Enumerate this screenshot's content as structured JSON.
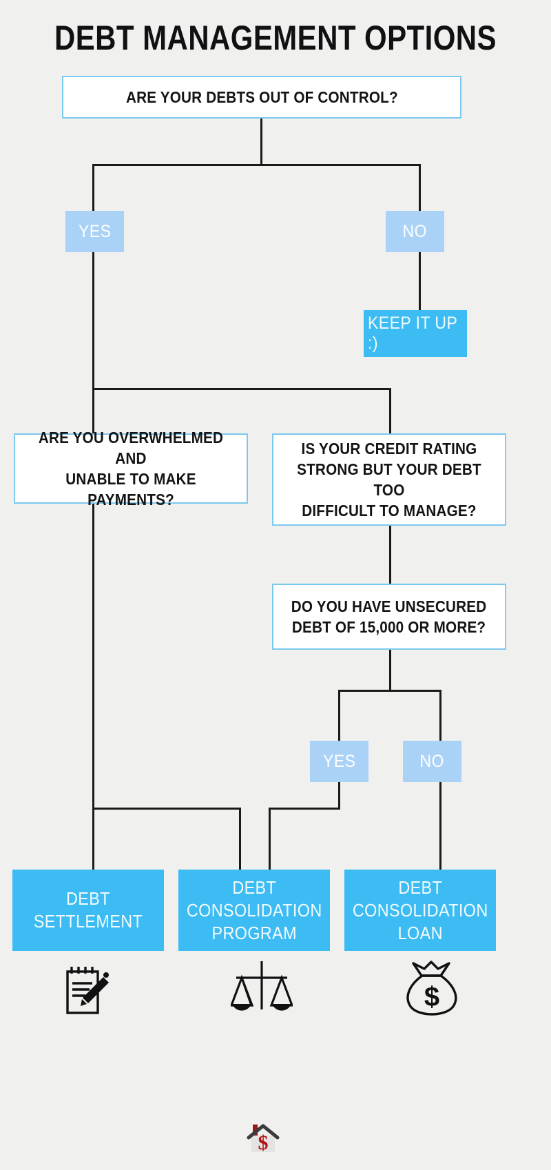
{
  "header": {
    "title": "DEBT MANAGEMENT OPTIONS"
  },
  "colors": {
    "background": "#f0f0ef",
    "accent_light_blue": "#aad2f7",
    "accent_bright_blue": "#3cbcf2",
    "box_border": "#7dc8ef",
    "box_fill": "#ffffff",
    "line": "#1a1a1a",
    "title_text": "#111111",
    "logo_red": "#b41414"
  },
  "nodes": {
    "root_question": "ARE YOUR DEBTS OUT OF CONTROL?",
    "branch_yes_top": "YES",
    "branch_no_top": "NO",
    "keep_it_up": "KEEP IT UP  :)",
    "question_left_line1": "ARE YOU OVERWHELMED AND",
    "question_left_line2": "UNABLE TO MAKE PAYMENTS?",
    "question_right_line1": "IS YOUR CREDIT RATING",
    "question_right_line2": "STRONG BUT YOUR DEBT TOO",
    "question_right_line3": "DIFFICULT TO MANAGE?",
    "question_unsecured_line1": "DO YOU HAVE UNSECURED",
    "question_unsecured_line2": "DEBT OF 15,000 OR MORE?",
    "branch_yes_bottom": "YES",
    "branch_no_bottom": "NO"
  },
  "results": [
    {
      "line1": "DEBT",
      "line2": "SETTLEMENT",
      "line3": "",
      "icon": "notepad-pencil-icon"
    },
    {
      "line1": "DEBT",
      "line2": "CONSOLIDATION",
      "line3": "PROGRAM",
      "icon": "balance-scales-icon"
    },
    {
      "line1": "DEBT",
      "line2": "CONSOLIDATION",
      "line3": "LOAN",
      "icon": "money-bag-icon"
    }
  ],
  "footer": {
    "logo": "house-dollar-logo"
  },
  "chart_data": {
    "type": "diagram",
    "title": "DEBT MANAGEMENT OPTIONS",
    "diagram_kind": "flowchart",
    "nodes": [
      {
        "id": "q0",
        "kind": "question",
        "text": "ARE YOUR DEBTS OUT OF CONTROL?"
      },
      {
        "id": "yes0",
        "kind": "branch",
        "text": "YES"
      },
      {
        "id": "no0",
        "kind": "branch",
        "text": "NO"
      },
      {
        "id": "keep",
        "kind": "terminal",
        "text": "KEEP IT UP  :)"
      },
      {
        "id": "q1",
        "kind": "question",
        "text": "ARE YOU OVERWHELMED AND UNABLE TO MAKE PAYMENTS?"
      },
      {
        "id": "q2",
        "kind": "question",
        "text": "IS YOUR CREDIT RATING STRONG BUT YOUR DEBT TOO DIFFICULT TO MANAGE?"
      },
      {
        "id": "q3",
        "kind": "question",
        "text": "DO YOU HAVE UNSECURED DEBT OF 15,000 OR MORE?"
      },
      {
        "id": "yes1",
        "kind": "branch",
        "text": "YES"
      },
      {
        "id": "no1",
        "kind": "branch",
        "text": "NO"
      },
      {
        "id": "r1",
        "kind": "result",
        "text": "DEBT SETTLEMENT"
      },
      {
        "id": "r2",
        "kind": "result",
        "text": "DEBT CONSOLIDATION PROGRAM"
      },
      {
        "id": "r3",
        "kind": "result",
        "text": "DEBT CONSOLIDATION LOAN"
      }
    ],
    "edges": [
      {
        "from": "q0",
        "to": "yes0"
      },
      {
        "from": "q0",
        "to": "no0"
      },
      {
        "from": "no0",
        "to": "keep"
      },
      {
        "from": "yes0",
        "to": "q1"
      },
      {
        "from": "yes0",
        "to": "q2"
      },
      {
        "from": "q1",
        "to": "r1"
      },
      {
        "from": "q2",
        "to": "q3"
      },
      {
        "from": "q3",
        "to": "yes1"
      },
      {
        "from": "q3",
        "to": "no1"
      },
      {
        "from": "yes1",
        "to": "r2"
      },
      {
        "from": "no1",
        "to": "r3"
      }
    ]
  }
}
